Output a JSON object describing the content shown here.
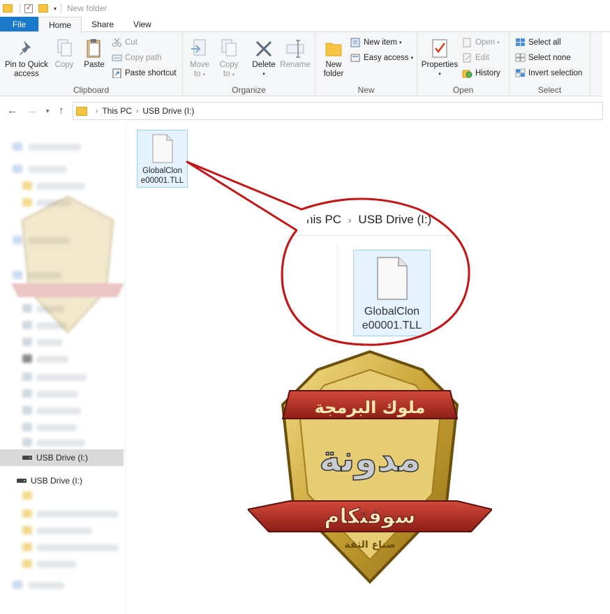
{
  "titlebar": {
    "title": "New folder"
  },
  "tabs": [
    {
      "label": "File"
    },
    {
      "label": "Home"
    },
    {
      "label": "Share"
    },
    {
      "label": "View"
    }
  ],
  "ribbon": {
    "clipboard": {
      "group_label": "Clipboard",
      "pin_line1": "Pin to Quick",
      "pin_line2": "access",
      "copy": "Copy",
      "paste": "Paste",
      "cut": "Cut",
      "copy_path": "Copy path",
      "paste_shortcut": "Paste shortcut"
    },
    "organize": {
      "group_label": "Organize",
      "move_to_1": "Move",
      "move_to_2": "to",
      "copy_to_1": "Copy",
      "copy_to_2": "to",
      "delete": "Delete",
      "rename": "Rename"
    },
    "new": {
      "group_label": "New",
      "new_folder_1": "New",
      "new_folder_2": "folder",
      "new_item": "New item",
      "easy_access": "Easy access"
    },
    "open": {
      "group_label": "Open",
      "properties": "Properties",
      "open": "Open",
      "edit": "Edit",
      "history": "History"
    },
    "select": {
      "group_label": "Select",
      "select_all": "Select all",
      "select_none": "Select none",
      "invert": "Invert selection"
    }
  },
  "address": {
    "crumbs": [
      "This PC",
      "USB Drive (I:)"
    ]
  },
  "navpane": {
    "selected": "USB Drive (I:)",
    "item": "USB Drive (I:)"
  },
  "content": {
    "file_name": "GlobalClone00001.TLL",
    "file_name_line1": "GlobalClon",
    "file_name_line2": "e00001.TLL"
  },
  "zoom": {
    "crumb1": "his PC",
    "crumb2": "USB Drive (I:)",
    "name_line1": "GlobalClon",
    "name_line2": "e00001.TLL"
  },
  "emblem": {
    "top_banner": "ملوك البرمجة",
    "middle": "مدونة",
    "ribbon": "سوفتكام",
    "tagline": "صناع الثقة"
  },
  "colors": {
    "file_tab": "#1979ca",
    "selection_bg": "#e5f3ff",
    "selection_border": "#99d1ff",
    "callout": "#c01818",
    "shield_gold": "#d8b84a",
    "ribbon_red": "#b83030"
  }
}
